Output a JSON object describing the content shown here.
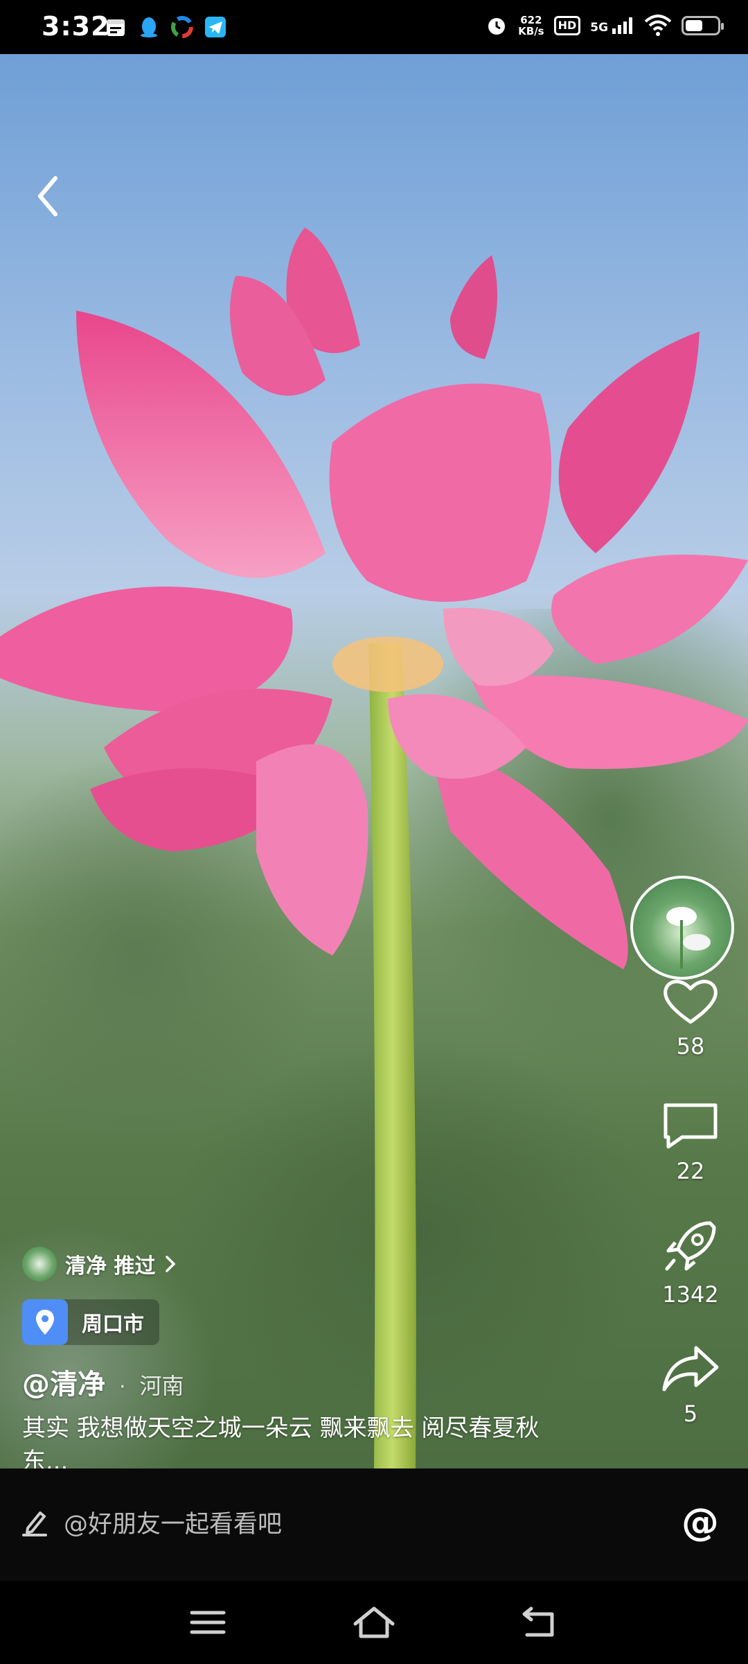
{
  "status_bar": {
    "time": "3:32",
    "left_icons": [
      "calendar-icon",
      "qq-icon",
      "color-ring-icon",
      "telegram-icon"
    ],
    "net_speed_value": "622",
    "net_speed_unit": "KB/s",
    "hd": "HD",
    "network": "5G",
    "battery_level_percent": 55
  },
  "video": {
    "progress_fraction": 0.2
  },
  "actions": {
    "like_count": "58",
    "comment_count": "22",
    "boost_count": "1342",
    "share_count": "5"
  },
  "post": {
    "recommender_text": "清净 推过",
    "location": "周口市",
    "author": "@清净",
    "separator": "·",
    "region": "河南",
    "caption": "其实 我想做天空之城一朵云 飘来飘去 阅尽春夏秋东..."
  },
  "comment_bar": {
    "placeholder": "@好朋友一起看看吧",
    "at_symbol": "@"
  },
  "nav_bar": {
    "buttons": [
      "menu-icon",
      "home-icon",
      "back-icon"
    ]
  }
}
